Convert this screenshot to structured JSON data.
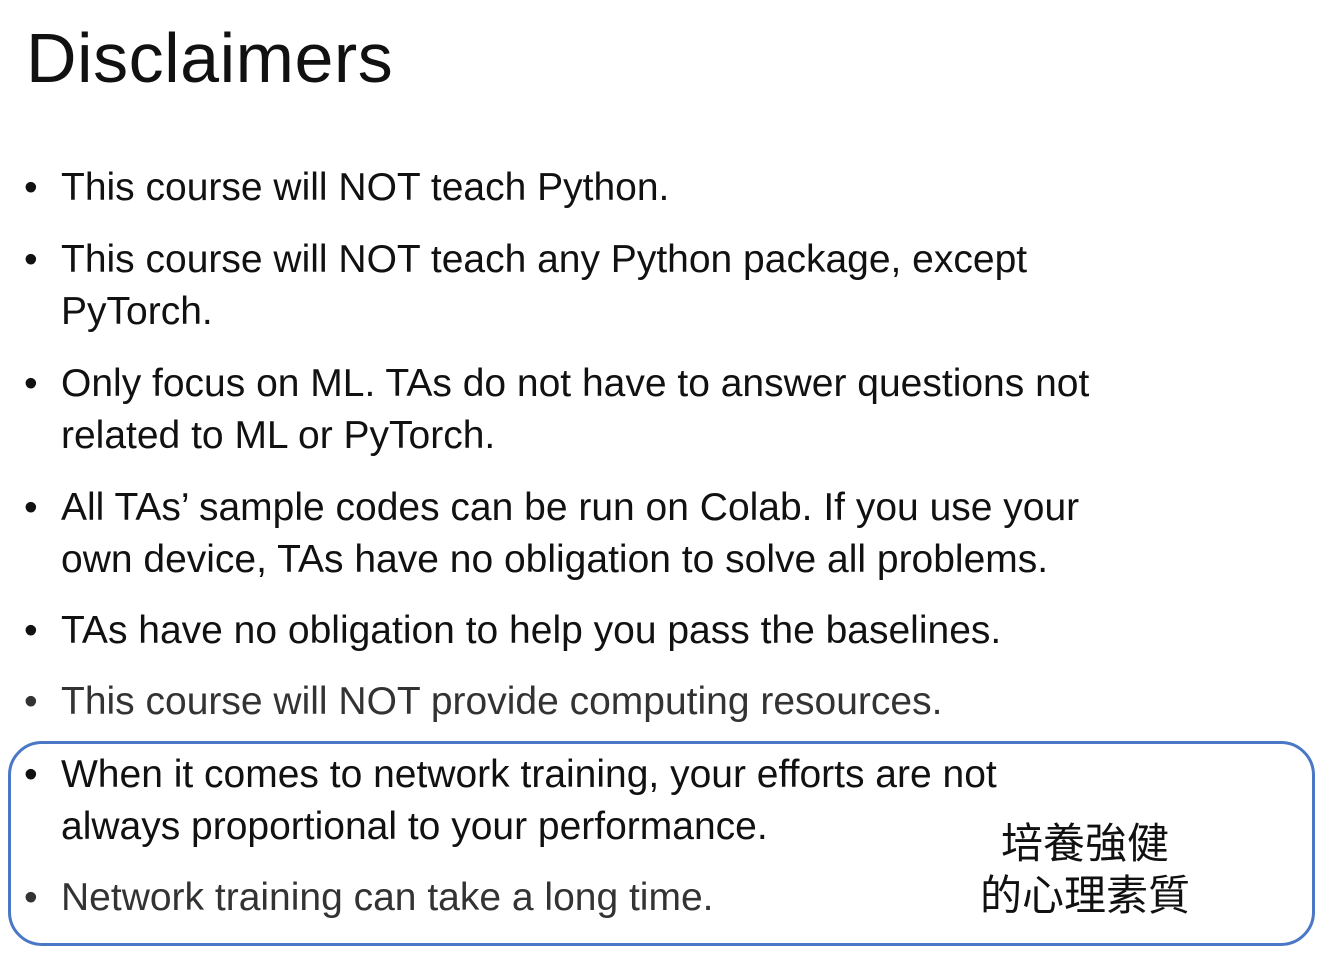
{
  "slide": {
    "title": "Disclaimers",
    "bullets": [
      {
        "lines": [
          "This course will NOT teach Python."
        ]
      },
      {
        "lines": [
          "This course will NOT teach any Python package, except",
          "PyTorch."
        ]
      },
      {
        "lines": [
          "Only focus on ML. TAs do not have to answer questions not",
          "related to ML or PyTorch."
        ]
      },
      {
        "lines": [
          "All TAs’ sample codes can be run on Colab. If you use your",
          "own device, TAs have no obligation to solve all problems."
        ]
      },
      {
        "lines": [
          "TAs have no obligation to help you pass the baselines."
        ]
      },
      {
        "lines": [
          "This course will NOT provide computing resources."
        ]
      },
      {
        "lines": [
          "When it comes to network training, your efforts are not",
          "always proportional to your performance."
        ]
      },
      {
        "lines": [
          "Network training can take a long time."
        ]
      }
    ],
    "bullet_glyph": "•",
    "note": {
      "line1": "培養強健",
      "line2": "的心理素質"
    },
    "colors": {
      "text": "#111111",
      "box_border": "#4a78c6"
    }
  }
}
